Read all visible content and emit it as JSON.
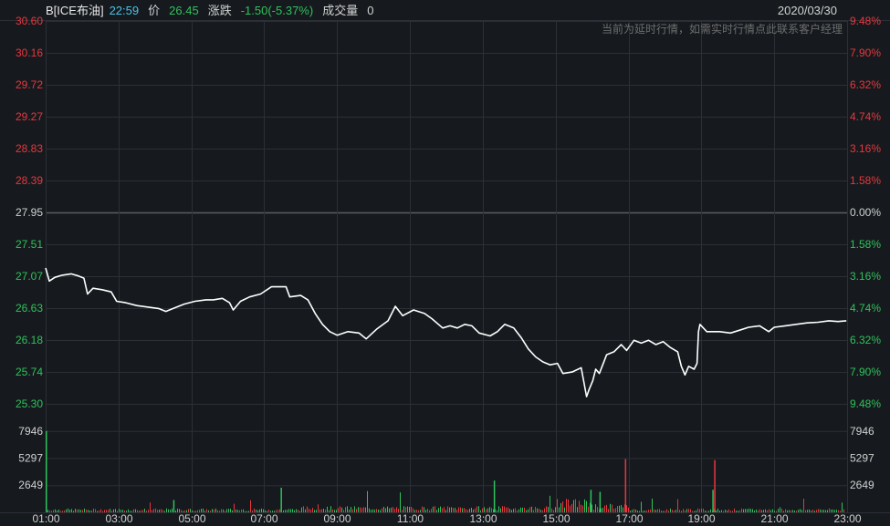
{
  "header": {
    "symbol": "B[ICE布油]",
    "time": "22:59",
    "price_label": "价",
    "price": "26.45",
    "change_label": "涨跌",
    "change": "-1.50(-5.37%)",
    "volume_label": "成交量",
    "volume": "0",
    "date": "2020/03/30",
    "delay_note": "当前为延时行情，如需实时行情点此联系客户经理"
  },
  "colors": {
    "background": "#161a1e",
    "grid": "#2c3036",
    "up": "#e8363c",
    "down": "#2fc15b",
    "neutral": "#d0d0d0",
    "price_line": "#ffffff"
  },
  "chart_data": {
    "type": "line",
    "title": "",
    "xlabel": "",
    "ylabel": "",
    "reference_price": 27.95,
    "price_ticks": [
      "30.60",
      "30.16",
      "29.72",
      "29.27",
      "28.83",
      "28.39",
      "27.95",
      "27.51",
      "27.07",
      "26.63",
      "26.18",
      "25.74",
      "25.30"
    ],
    "pct_ticks": [
      "9.48%",
      "7.90%",
      "6.32%",
      "4.74%",
      "3.16%",
      "1.58%",
      "0.00%",
      "1.58%",
      "3.16%",
      "4.74%",
      "6.32%",
      "7.90%",
      "9.48%"
    ],
    "ylim": [
      25.3,
      30.6
    ],
    "volume_ticks": [
      "7946",
      "5297",
      "2649"
    ],
    "volume_ylim": [
      0,
      10595
    ],
    "time_ticks": [
      "01:00",
      "03:00",
      "05:00",
      "07:00",
      "09:00",
      "11:00",
      "13:00",
      "15:00",
      "17:00",
      "19:00",
      "21:00",
      "23:00"
    ],
    "x_unit": "hour",
    "xlim": [
      1,
      23
    ],
    "price_series": [
      [
        1.0,
        27.18
      ],
      [
        1.1,
        27.0
      ],
      [
        1.25,
        27.05
      ],
      [
        1.45,
        27.08
      ],
      [
        1.7,
        27.1
      ],
      [
        1.9,
        27.07
      ],
      [
        2.05,
        27.04
      ],
      [
        2.15,
        26.82
      ],
      [
        2.3,
        26.9
      ],
      [
        2.55,
        26.88
      ],
      [
        2.8,
        26.85
      ],
      [
        2.95,
        26.72
      ],
      [
        3.2,
        26.7
      ],
      [
        3.5,
        26.66
      ],
      [
        3.8,
        26.64
      ],
      [
        4.1,
        26.62
      ],
      [
        4.3,
        26.58
      ],
      [
        4.5,
        26.62
      ],
      [
        4.8,
        26.68
      ],
      [
        5.1,
        26.72
      ],
      [
        5.4,
        26.74
      ],
      [
        5.6,
        26.74
      ],
      [
        5.85,
        26.76
      ],
      [
        6.05,
        26.7
      ],
      [
        6.15,
        26.6
      ],
      [
        6.35,
        26.72
      ],
      [
        6.6,
        26.78
      ],
      [
        6.9,
        26.82
      ],
      [
        7.2,
        26.92
      ],
      [
        7.6,
        26.92
      ],
      [
        7.7,
        26.78
      ],
      [
        8.0,
        26.8
      ],
      [
        8.2,
        26.74
      ],
      [
        8.4,
        26.55
      ],
      [
        8.6,
        26.4
      ],
      [
        8.8,
        26.3
      ],
      [
        9.0,
        26.25
      ],
      [
        9.3,
        26.3
      ],
      [
        9.6,
        26.28
      ],
      [
        9.8,
        26.2
      ],
      [
        10.1,
        26.34
      ],
      [
        10.4,
        26.45
      ],
      [
        10.6,
        26.65
      ],
      [
        10.8,
        26.52
      ],
      [
        11.1,
        26.6
      ],
      [
        11.4,
        26.55
      ],
      [
        11.6,
        26.48
      ],
      [
        11.9,
        26.35
      ],
      [
        12.1,
        26.38
      ],
      [
        12.3,
        26.35
      ],
      [
        12.5,
        26.4
      ],
      [
        12.7,
        26.38
      ],
      [
        12.9,
        26.28
      ],
      [
        13.2,
        26.24
      ],
      [
        13.4,
        26.3
      ],
      [
        13.6,
        26.4
      ],
      [
        13.85,
        26.35
      ],
      [
        14.05,
        26.22
      ],
      [
        14.25,
        26.06
      ],
      [
        14.45,
        25.95
      ],
      [
        14.65,
        25.88
      ],
      [
        14.85,
        25.84
      ],
      [
        15.05,
        25.86
      ],
      [
        15.2,
        25.72
      ],
      [
        15.45,
        25.74
      ],
      [
        15.7,
        25.8
      ],
      [
        15.85,
        25.4
      ],
      [
        15.92,
        25.5
      ],
      [
        16.02,
        25.62
      ],
      [
        16.1,
        25.78
      ],
      [
        16.2,
        25.72
      ],
      [
        16.4,
        25.98
      ],
      [
        16.6,
        26.02
      ],
      [
        16.8,
        26.12
      ],
      [
        16.95,
        26.04
      ],
      [
        17.15,
        26.18
      ],
      [
        17.35,
        26.14
      ],
      [
        17.55,
        26.18
      ],
      [
        17.75,
        26.12
      ],
      [
        17.95,
        26.16
      ],
      [
        18.15,
        26.08
      ],
      [
        18.35,
        26.02
      ],
      [
        18.45,
        25.82
      ],
      [
        18.55,
        25.7
      ],
      [
        18.65,
        25.82
      ],
      [
        18.8,
        25.78
      ],
      [
        18.88,
        25.86
      ],
      [
        18.92,
        26.3
      ],
      [
        18.96,
        26.4
      ],
      [
        19.15,
        26.3
      ],
      [
        19.5,
        26.3
      ],
      [
        19.8,
        26.28
      ],
      [
        20.05,
        26.32
      ],
      [
        20.3,
        26.36
      ],
      [
        20.6,
        26.38
      ],
      [
        20.85,
        26.3
      ],
      [
        21.0,
        26.36
      ],
      [
        21.3,
        26.38
      ],
      [
        21.6,
        26.4
      ],
      [
        21.9,
        26.42
      ],
      [
        22.2,
        26.43
      ],
      [
        22.5,
        26.45
      ],
      [
        22.75,
        26.44
      ],
      [
        22.98,
        26.45
      ]
    ]
  }
}
